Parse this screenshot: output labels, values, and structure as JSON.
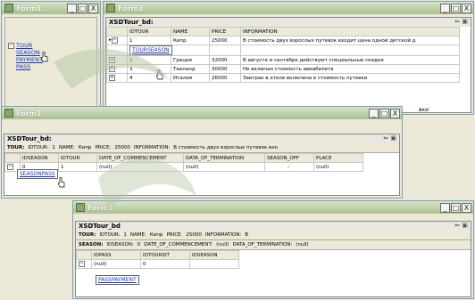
{
  "win1": {
    "title": "Form1",
    "links": [
      "TOUR",
      "SEASON",
      "PAYMENT",
      "PASS"
    ]
  },
  "win2": {
    "title": "Form1",
    "grid_caption": "XSDTour_bd:",
    "columns": [
      "IDTOUR",
      "NAME",
      "PRICE",
      "INFORMATION"
    ],
    "rows": [
      {
        "id": "1",
        "name": "Кипр",
        "price": "25000",
        "info": "В стоимость двух взрослых путевок входит цена одной детской д"
      },
      {
        "id": "2",
        "name": "Греция",
        "price": "32000",
        "info": "В августе и сентябре действуют специальные скидки"
      },
      {
        "id": "3",
        "name": "Таиланд",
        "price": "30000",
        "info": "Не включая стоимость авиабилета"
      },
      {
        "id": "4",
        "name": "Италия",
        "price": "26000",
        "info": "Завтрак в отеле включена в стоимость путевки"
      }
    ],
    "relation_link": "TOURSEASON",
    "overflow_text": "вки"
  },
  "win3": {
    "title": "Form1",
    "grid_caption": "XSDTour_bd:",
    "parent_row": {
      "table": "TOUR:",
      "idtour_label": "IDTOUR:",
      "idtour": "1",
      "name_label": "NAME:",
      "name": "Кипр",
      "price_label": "PRICE:",
      "price": "25000",
      "info_label": "INFORMATION:",
      "info": "В стоимость двух взрослых путевок вхо"
    },
    "columns": [
      "IDSEASON",
      "IDTOUR",
      "DATE_OF_COMMENCEMENT",
      "DATA_OF_TERMINATION",
      "SEASON_OFF",
      "PLACE"
    ],
    "row": {
      "idseason": "0",
      "idtour": "1",
      "date_start": "(null)",
      "date_end": "(null)",
      "season_off": "✓",
      "place": "(null)"
    },
    "relation_link": "SEASONPASS"
  },
  "win4": {
    "title": "Form1",
    "grid_caption": "XSDTour_bd",
    "parent_row1": {
      "table": "TOUR:",
      "idtour_label": "IDTOUR:",
      "idtour": "1",
      "name_label": "NAME:",
      "name": "Кипр",
      "price_label": "PRICE:",
      "price": "25000",
      "info_label": "INFORMATION:",
      "info": "В"
    },
    "parent_row2": {
      "table": "SEASON:",
      "idseason_label": "IDSEASON:",
      "idseason": "0",
      "date_label": "DATE_OF_COMMENCEMENT:",
      "date": "(null)",
      "term_label": "DATA_OF_TERMINATION:",
      "term": "(null)"
    },
    "columns": [
      "IDPASS",
      "IDTOURIST",
      "IDSEASON"
    ],
    "row": {
      "idpass": "(null)",
      "idtourist": "0",
      "idseason": ""
    },
    "relation_link": "PASSPAYMENT"
  },
  "controls": {
    "min": "_",
    "max": "□",
    "close": "X"
  },
  "colors": {
    "link": "#1c37b6",
    "titlebar": "#a9c08e"
  }
}
